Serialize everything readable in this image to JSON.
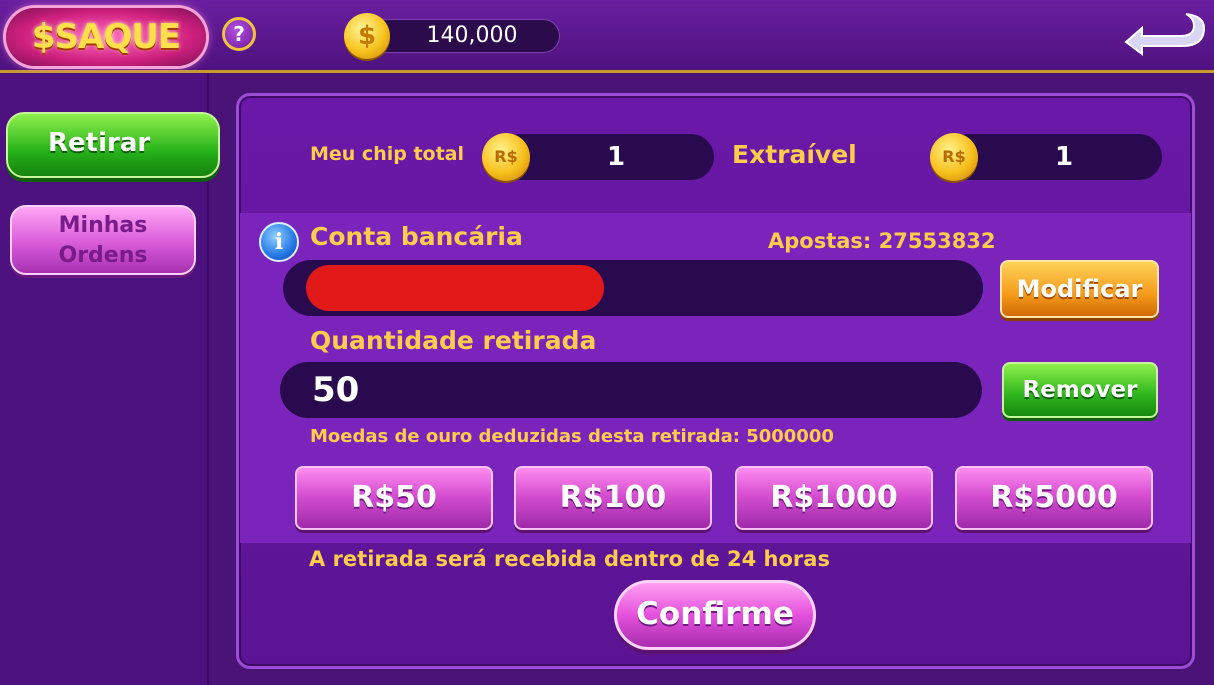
{
  "header": {
    "logo_text": "$SAQUE",
    "help_label": "?",
    "balance": "140,000",
    "coin_symbol": "$"
  },
  "sidebar": {
    "retirar_label": "Retirar",
    "minhas_line1": "Minhas",
    "minhas_line2": "Ordens"
  },
  "chips": {
    "total_label": "Meu chip total",
    "total_value": "1",
    "extraivel_label": "Extraível",
    "extraivel_value": "1",
    "currency_badge": "R$"
  },
  "bank": {
    "label": "Conta bancária",
    "apostas": "Apostas: 27553832",
    "modify_label": "Modificar"
  },
  "withdraw": {
    "label": "Quantidade retirada",
    "amount": "50",
    "remove_label": "Remover",
    "deduction_note": "Moedas de ouro deduzidas desta retirada: 5000000",
    "presets": [
      "R$50",
      "R$100",
      "R$1000",
      "R$5000"
    ],
    "notice": "A retirada será recebida dentro de 24 horas",
    "confirm_label": "Confirme"
  },
  "colors": {
    "accent_text": "#ffcd4a",
    "panel": "#6b18a8",
    "field": "#2a0a4e"
  }
}
